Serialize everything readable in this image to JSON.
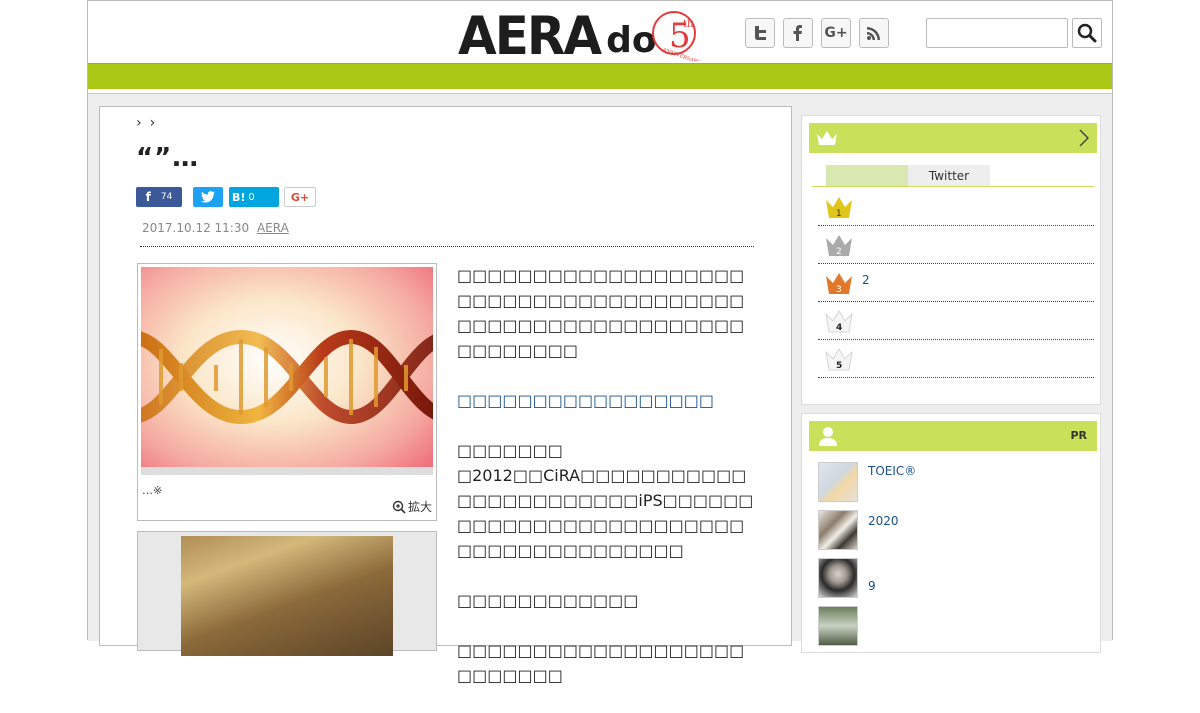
{
  "header": {
    "logo_main": "AERA",
    "logo_dot": "dot",
    "logo_period": ".",
    "badge_number": "5",
    "badge_suffix": "th",
    "badge_text": "ANNIVERSARY",
    "social": [
      "twitter-icon",
      "facebook-icon",
      "google-plus-icon",
      "rss-icon"
    ],
    "search_placeholder": "",
    "brand_color": "#aac815"
  },
  "article": {
    "breadcrumb": [
      "›",
      "›"
    ],
    "title": "“”…",
    "share": {
      "facebook_count": "74",
      "hatena_label": "B!",
      "hatena_count": "0",
      "gplus_label": "G+"
    },
    "date": "2017.10.12 11:30",
    "source": "AERA",
    "photo_caption": "…※",
    "zoom_label": "拡大",
    "paragraphs": [
      "□□□□□□□□□□□□□□□□□□□□□□□□□□□□□□□□□□□□□□□□□□□□□□□□□□□□□□□□□□□□□□□□□",
      "□□□□□□□□□□□□□□□□□",
      "□□□□□□□",
      "□2012□□CiRA□□□□□□□□□□□□□□□□□□□□□□□iPS□□□□□□□□□□□□□□□□□□□□□□□□□□□□□□□□□□□□□□□□",
      "□□□□□□□□□□□□",
      "□□□□□□□□□□□□□□□□□□□□□□□□□□"
    ]
  },
  "ranking": {
    "tabs": [
      "",
      "Twitter"
    ],
    "items": [
      {
        "rank": "1",
        "text": "",
        "color": "#e0c619"
      },
      {
        "rank": "2",
        "text": "",
        "color": "#aaaaaa"
      },
      {
        "rank": "3",
        "text": "2",
        "color": "#e07a2a"
      },
      {
        "rank": "4",
        "text": "",
        "color": "#ffffff"
      },
      {
        "rank": "5",
        "text": "",
        "color": "#ffffff"
      }
    ]
  },
  "pr": {
    "label": "PR",
    "items": [
      {
        "text": "TOEIC®"
      },
      {
        "text": "2020"
      },
      {
        "text": "9"
      },
      {
        "text": ""
      }
    ]
  }
}
